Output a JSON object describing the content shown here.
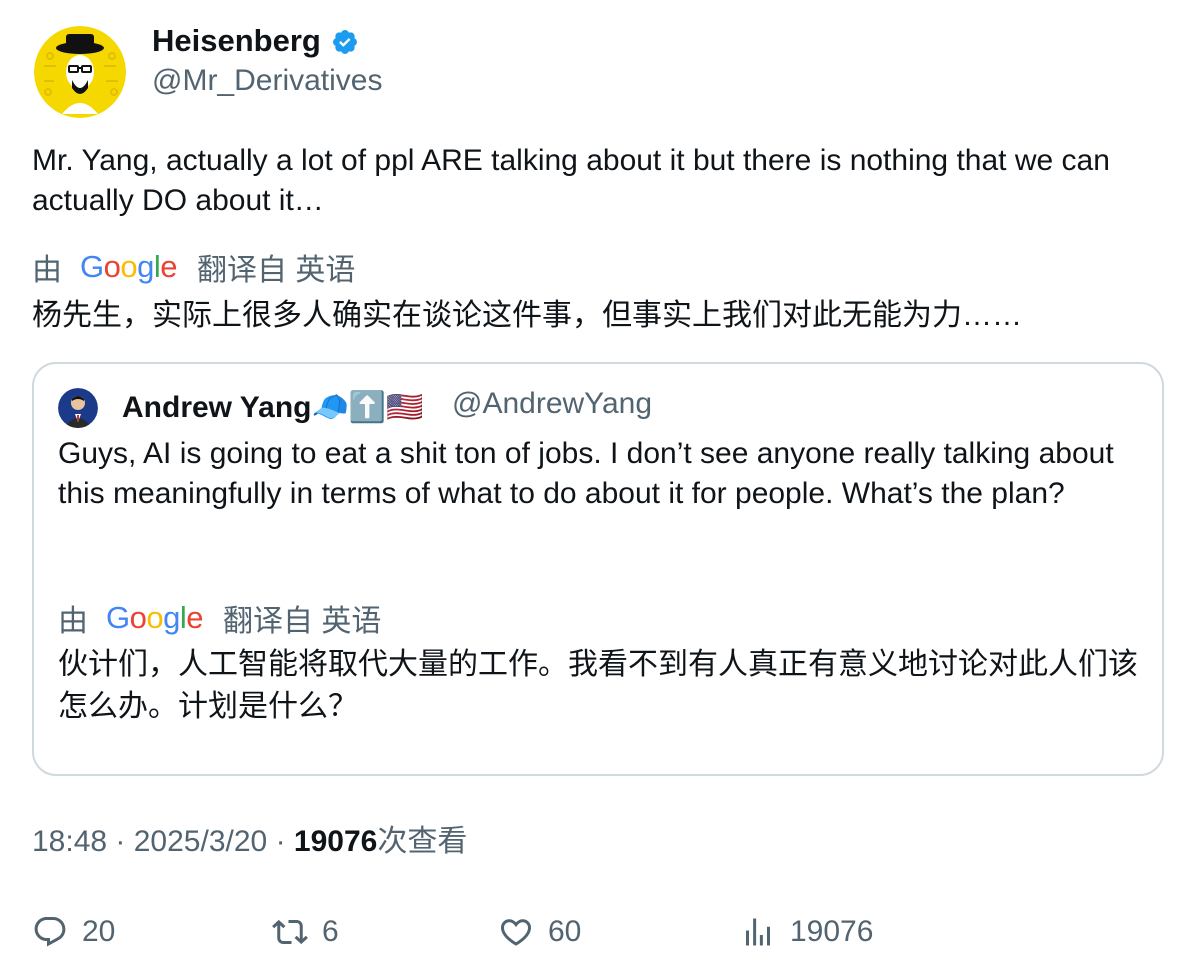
{
  "author": {
    "display_name": "Heisenberg",
    "handle": "@Mr_Derivatives",
    "verified": true,
    "avatar_icon": "heisenberg-avatar"
  },
  "tweet": {
    "text": "Mr. Yang, actually a lot of ppl ARE talking about it but there is nothing that we can actually DO about it…",
    "translation": {
      "by_label": "由",
      "provider": "Google",
      "from_label": "翻译自 英语",
      "text": "杨先生，实际上很多人确实在谈论这件事，但事实上我们对此无能为力……"
    }
  },
  "quoted_tweet": {
    "display_name": "Andrew Yang🧢⬆️🇺🇸",
    "handle": "@AndrewYang",
    "text": "Guys, AI is going to eat a shit ton of jobs.  I don’t see anyone really talking about this meaningfully in terms of what to do about it for people.  What’s the plan?",
    "translation": {
      "by_label": "由",
      "provider": "Google",
      "from_label": "翻译自 英语",
      "text": "伙计们，人工智能将取代大量的工作。我看不到有人真正有意义地讨论对此人们该怎么办。计划是什么？"
    }
  },
  "meta": {
    "time": "18:48",
    "separator": "·",
    "date": "2025/3/20",
    "views_count": "19076",
    "views_label": "次查看"
  },
  "actions": {
    "replies": "20",
    "retweets": "6",
    "likes": "60",
    "views": "19076"
  },
  "colors": {
    "text_primary": "#0f1419",
    "text_secondary": "#536471",
    "verified_blue": "#1d9bf0",
    "border": "#cfd9de",
    "google_blue": "#4285F4",
    "google_red": "#EA4335",
    "google_yellow": "#FBBC05",
    "google_green": "#34A853"
  }
}
